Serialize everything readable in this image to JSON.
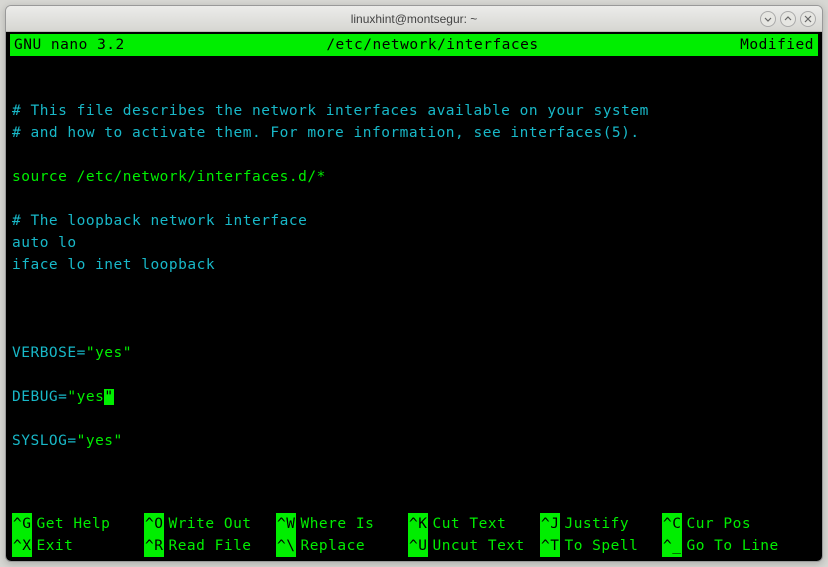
{
  "window": {
    "title": "linuxhint@montsegur: ~"
  },
  "nano": {
    "app": "GNU nano 3.2",
    "file": "/etc/network/interfaces",
    "status": "Modified"
  },
  "content": {
    "line1": "# This file describes the network interfaces available on your system",
    "line2": "# and how to activate them. For more information, see interfaces(5).",
    "blank1": "",
    "line3": "source /etc/network/interfaces.d/*",
    "blank2": "",
    "line4": "# The loopback network interface",
    "line5": "auto lo",
    "line6": "iface lo inet loopback",
    "blank3": "",
    "blank4": "",
    "blank5": "",
    "line7_pre": "VERBOSE=",
    "line7_val": "\"yes\"",
    "blank6": "",
    "line8_pre": "DEBUG=",
    "line8_val": "\"yes",
    "line8_cursor": "\"",
    "blank7": "",
    "line9_pre": "SYSLOG=",
    "line9_val": "\"yes\""
  },
  "shortcuts": {
    "row1": {
      "k1": "^G",
      "l1": "Get Help",
      "k2": "^O",
      "l2": "Write Out",
      "k3": "^W",
      "l3": "Where Is",
      "k4": "^K",
      "l4": "Cut Text",
      "k5": "^J",
      "l5": "Justify",
      "k6": "^C",
      "l6": "Cur Pos"
    },
    "row2": {
      "k1": "^X",
      "l1": "Exit",
      "k2": "^R",
      "l2": "Read File",
      "k3": "^\\",
      "l3": "Replace",
      "k4": "^U",
      "l4": "Uncut Text",
      "k5": "^T",
      "l5": "To Spell",
      "k6": "^_",
      "l6": "Go To Line"
    }
  }
}
